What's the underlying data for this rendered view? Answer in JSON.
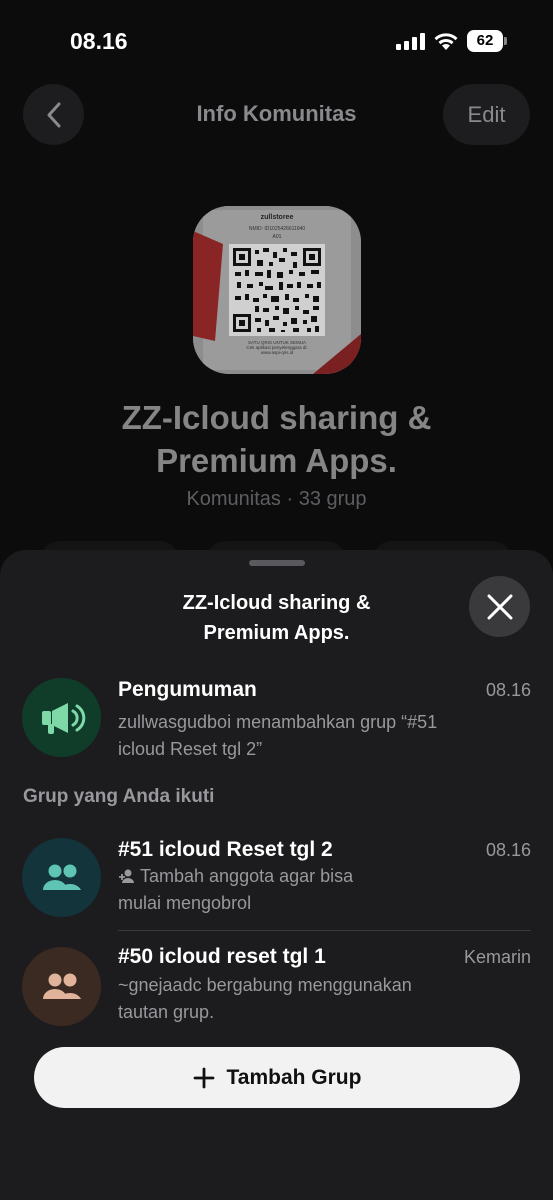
{
  "status_bar": {
    "time": "08.16",
    "battery": "62"
  },
  "header": {
    "title": "Info Komunitas",
    "edit_label": "Edit"
  },
  "community": {
    "name_line1": "ZZ-Icloud sharing &",
    "name_line2": "Premium Apps.",
    "subtitle": "Komunitas · 33 grup",
    "qr_card": {
      "merchant": "zullstoree",
      "nmid": "NMID: ID1025426611840",
      "code": "A01",
      "footer1": "SATU QRIS UNTUK SEMUA",
      "footer2": "Cek aplikasi penyelenggara di:",
      "footer3": "www.aspi-qris.id"
    }
  },
  "sheet": {
    "title_line1": "ZZ-Icloud sharing &",
    "title_line2": "Premium Apps.",
    "announcement": {
      "title": "Pengumuman",
      "time": "08.16",
      "desc_line1": "zullwasgudboi menambahkan grup “#51",
      "desc_line2": "icloud Reset tgl 2”"
    },
    "section_label": "Grup yang Anda ikuti",
    "groups": [
      {
        "title": "#51 icloud Reset tgl 2",
        "time": "08.16",
        "desc_line1": "Tambah anggota agar bisa",
        "desc_line2": "mulai mengobrol",
        "avatar_bg": "#12343a",
        "icon_color": "#5fc4b4"
      },
      {
        "title": "#50 icloud reset tgl 1",
        "time": "Kemarin",
        "desc_line1": "~gnejaadc bergabung menggunakan",
        "desc_line2": "tautan grup.",
        "avatar_bg": "#3b2a22",
        "icon_color": "#e0b39a"
      }
    ],
    "add_group_label": "Tambah Grup"
  }
}
